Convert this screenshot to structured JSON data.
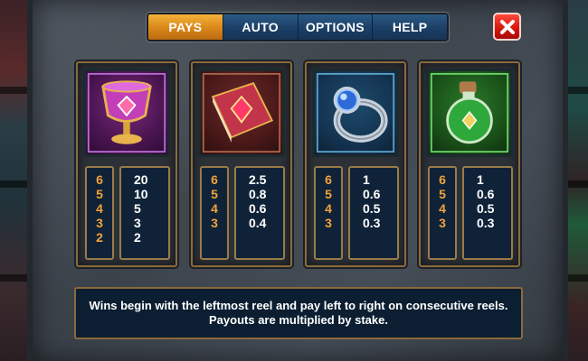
{
  "tabs": [
    {
      "label": "PAYS",
      "active": true
    },
    {
      "label": "AUTO",
      "active": false
    },
    {
      "label": "OPTIONS",
      "active": false
    },
    {
      "label": "HELP",
      "active": false
    }
  ],
  "close": {
    "icon": "close-icon"
  },
  "symbols": [
    {
      "name": "chalice",
      "icon": "chalice-icon",
      "multipliers": [
        "6",
        "5",
        "4",
        "3",
        "2"
      ],
      "payouts": [
        "20",
        "10",
        "5",
        "3",
        "2"
      ]
    },
    {
      "name": "spellbook",
      "icon": "spellbook-icon",
      "multipliers": [
        "6",
        "5",
        "4",
        "3"
      ],
      "payouts": [
        "2.5",
        "0.8",
        "0.6",
        "0.4"
      ]
    },
    {
      "name": "ring",
      "icon": "ring-icon",
      "multipliers": [
        "6",
        "5",
        "4",
        "3"
      ],
      "payouts": [
        "1",
        "0.6",
        "0.5",
        "0.3"
      ]
    },
    {
      "name": "potion",
      "icon": "potion-icon",
      "multipliers": [
        "6",
        "5",
        "4",
        "3"
      ],
      "payouts": [
        "1",
        "0.6",
        "0.5",
        "0.3"
      ]
    }
  ],
  "info": {
    "line1": "Wins begin with the leftmost reel and pay left to right on consecutive reels.",
    "line2": "Payouts are multiplied by stake."
  },
  "colors": {
    "accent": "#e39a25",
    "tab": "#1b3f66",
    "close": "#d4150c",
    "multiplier": "#f2a33a"
  }
}
